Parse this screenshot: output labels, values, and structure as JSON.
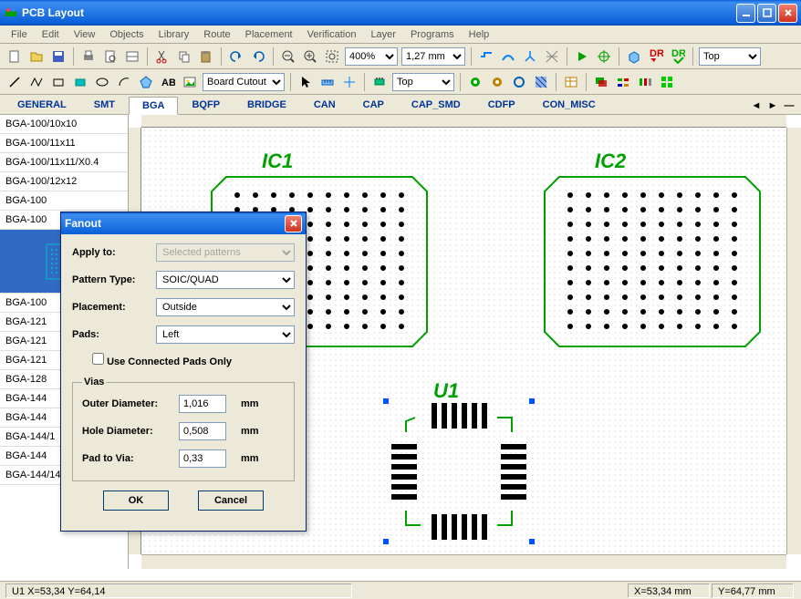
{
  "app": {
    "title": "PCB Layout"
  },
  "menu": [
    "File",
    "Edit",
    "View",
    "Objects",
    "Library",
    "Route",
    "Placement",
    "Verification",
    "Layer",
    "Programs",
    "Help"
  ],
  "toolbar1": {
    "zoom": "400%",
    "grid": "1,27 mm",
    "layer": "Top"
  },
  "toolbar2": {
    "shape": "Board Cutout",
    "routeLayer": "Top"
  },
  "tabs": {
    "items": [
      "GENERAL",
      "SMT",
      "BGA",
      "BQFP",
      "BRIDGE",
      "CAN",
      "CAP",
      "CAP_SMD",
      "CDFP",
      "CON_MISC"
    ],
    "activeIndex": 2
  },
  "sidebar": {
    "items": [
      "BGA-100/10x10",
      "BGA-100/11x11",
      "BGA-100/11x11/X0.4",
      "BGA-100/12x12",
      "BGA-100",
      "BGA-100",
      "",
      "BGA-100",
      "BGA-121",
      "BGA-121",
      "BGA-121",
      "BGA-128",
      "BGA-144",
      "BGA-144",
      "BGA-144/1",
      "BGA-144",
      "BGA-144/14x14"
    ]
  },
  "canvas": {
    "ic1": "IC1",
    "ic2": "IC2",
    "u1": "U1"
  },
  "dialog": {
    "title": "Fanout",
    "labels": {
      "applyTo": "Apply to:",
      "patternType": "Pattern Type:",
      "placement": "Placement:",
      "pads": "Pads:",
      "connectedPadsOnly": "Use Connected Pads Only",
      "viasGroup": "Vias",
      "outerDiameter": "Outer Diameter:",
      "holeDiameter": "Hole Diameter:",
      "padToVia": "Pad to Via:",
      "ok": "OK",
      "cancel": "Cancel",
      "unit": "mm"
    },
    "values": {
      "applyTo": "Selected patterns",
      "patternType": "SOIC/QUAD",
      "placement": "Outside",
      "pads": "Left",
      "outerDiameter": "1,016",
      "holeDiameter": "0,508",
      "padToVia": "0,33"
    }
  },
  "status": {
    "left": "U1  X=53,34  Y=64,14",
    "x": "X=53,34 mm",
    "y": "Y=64,77 mm"
  }
}
